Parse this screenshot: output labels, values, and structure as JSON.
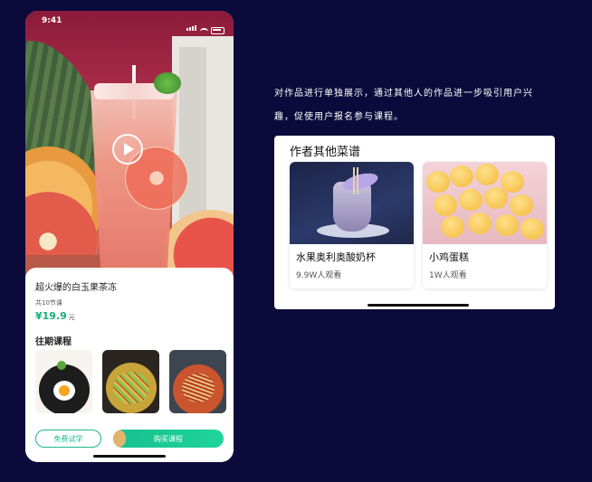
{
  "status_bar": {
    "time": "9:41"
  },
  "product": {
    "title": "超火爆的白玉果茶冻",
    "lessons": "共10节课",
    "price": "¥19.9",
    "price_unit": "元"
  },
  "past_courses": {
    "heading": "往期课程"
  },
  "actions": {
    "free_trial": "免费试学",
    "buy": "购买课程"
  },
  "description": {
    "line1": "对作品进行单独展示，通过其他人的作品进一步吸引用户兴",
    "line2": "趣，促使用户报名参与课程。"
  },
  "other_works": {
    "heading": "作者其他菜谱",
    "items": [
      {
        "name": "水果奥利奥酸奶杯",
        "views": "9.9W人观看"
      },
      {
        "name": "小鸡蛋糕",
        "views": "1W人观看"
      }
    ]
  },
  "colors": {
    "accent": "#17b98a",
    "background": "#0b0a3b"
  }
}
